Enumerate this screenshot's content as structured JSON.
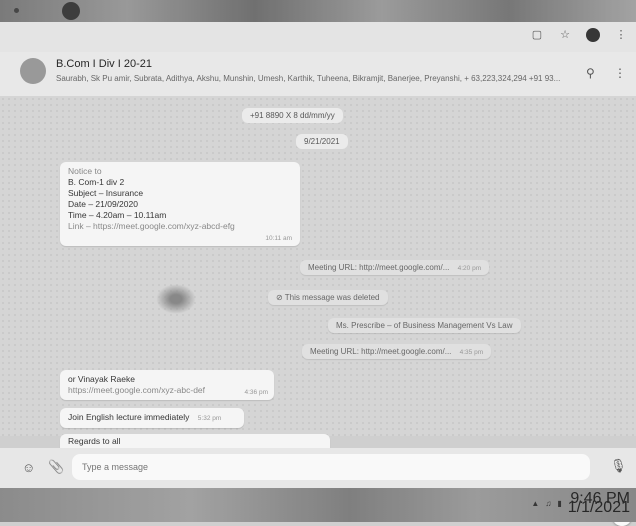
{
  "browser": {
    "icons": [
      "tab-icon",
      "star-icon",
      "profile-icon",
      "menu-icon"
    ]
  },
  "header": {
    "title": "B.Com I Div I 20-21",
    "members": "Saurabh, Sk Pu amir, Subrata, Adithya, Akshu, Munshin, Umesh, Karthik, Tuheena, Bikramjit, Banerjee, Preyanshi, + 63,223,324,294 +91 93..."
  },
  "messages": {
    "system_added": "+91 8890 X 8 dd/mm/yy",
    "date_pill": "9/21/2021",
    "notice_lines": [
      "Notice to",
      "B. Com-1 div 2",
      "Subject – Insurance",
      "Date – 21/09/2020",
      "Time – 4.20am – 10.11am",
      "Link – https://meet.google.com/xyz-abcd-efg"
    ],
    "notice_time": "10:11 am",
    "out_1": "Meeting URL: http://meet.google.com/...",
    "out_1_time": "4:20 pm",
    "out_deleted": "This message was deleted",
    "out_2": "Ms. Prescribe – of Business Management Vs Law",
    "out_3": "Meeting URL: http://meet.google.com/...",
    "out_3_time": "4:35 pm",
    "in_2_lines": [
      "or Vinayak Raeke",
      "https://meet.google.com/xyz-abc-def"
    ],
    "in_2_time": "4:36 pm",
    "in_3": "Join English lecture immediately",
    "in_3_time": "5:32 pm",
    "in_4": "Regards to all"
  },
  "composer": {
    "placeholder": "Type a message"
  },
  "taskbar": {
    "time": "9:46 PM",
    "date": "1/1/2021"
  }
}
